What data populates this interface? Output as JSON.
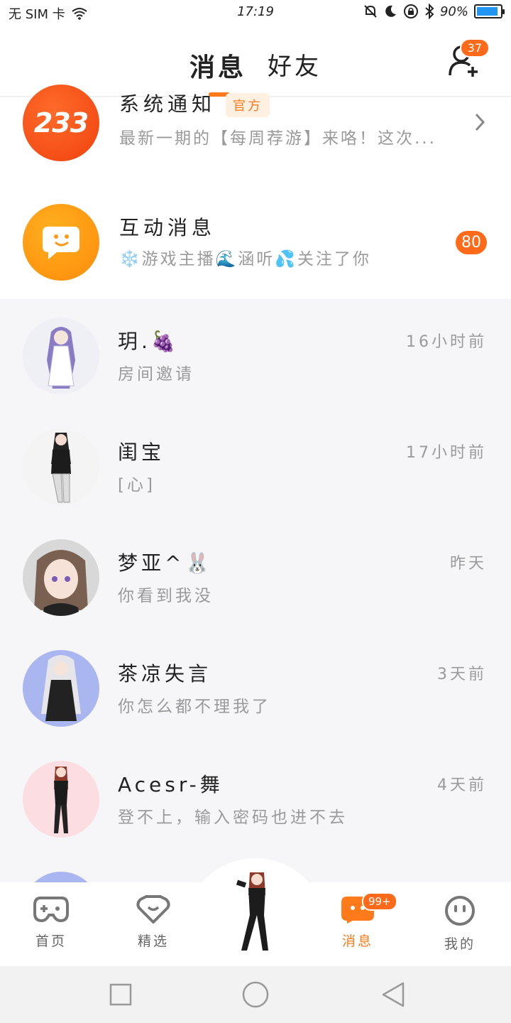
{
  "status_bar": {
    "carrier": "无 SIM 卡",
    "time": "17:19",
    "battery": "90%",
    "battery_level": 0.9
  },
  "header": {
    "tabs": [
      {
        "label": "消息",
        "active": true
      },
      {
        "label": "好友",
        "active": false
      }
    ],
    "add_friend_badge": "37"
  },
  "official": [
    {
      "name": "系统通知",
      "tag": "官方",
      "message": "最新一期的【每周荐游】来咯！这次...",
      "icon_text": "233",
      "icon": "logo-233-icon"
    },
    {
      "name": "互动消息",
      "message": "❄️游戏主播🌊涵听💦关注了你",
      "badge": "80",
      "icon": "chat-bubble-face-icon"
    }
  ],
  "chats": [
    {
      "name": "玥.🍇",
      "message": "房间邀请",
      "time": "16小时前",
      "avatar_bg": "#eef0f6"
    },
    {
      "name": "闺宝",
      "message": "[心]",
      "time": "17小时前",
      "avatar_bg": "#f4f4f4"
    },
    {
      "name": "梦亚^🐰",
      "message": "你看到我没",
      "time": "昨天",
      "avatar_bg": "#d8d8d8"
    },
    {
      "name": "茶凉失言",
      "message": "你怎么都不理我了",
      "time": "3天前",
      "avatar_bg": "#a9b6f0"
    },
    {
      "name": "Acesr-舞",
      "message": "登不上，输入密码也进不去",
      "time": "4天前",
      "avatar_bg": "#fcdde2"
    }
  ],
  "bottom_nav": [
    {
      "label": "首页",
      "icon": "gamepad-icon",
      "active": false
    },
    {
      "label": "精选",
      "icon": "heart-shield-icon",
      "active": false
    },
    {
      "label": "消息",
      "icon": "message-face-icon",
      "active": true,
      "badge": "99+"
    },
    {
      "label": "我的",
      "icon": "profile-face-icon",
      "active": false
    }
  ],
  "colors": {
    "accent": "#ff7a1a",
    "badge": "#ff6a1a",
    "muted": "#9a9a9a"
  }
}
